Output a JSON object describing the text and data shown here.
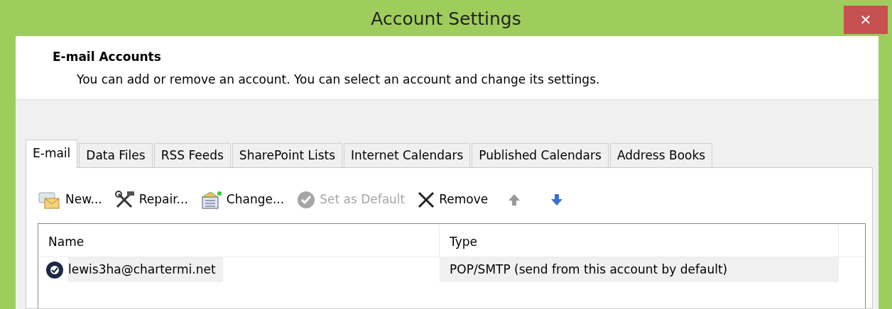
{
  "window": {
    "title": "Account Settings",
    "close": "✕"
  },
  "header": {
    "heading": "E-mail Accounts",
    "description": "You can add or remove an account. You can select an account and change its settings."
  },
  "tabs": [
    {
      "label": "E-mail",
      "selected": true
    },
    {
      "label": "Data Files",
      "selected": false
    },
    {
      "label": "RSS Feeds",
      "selected": false
    },
    {
      "label": "SharePoint Lists",
      "selected": false
    },
    {
      "label": "Internet Calendars",
      "selected": false
    },
    {
      "label": "Published Calendars",
      "selected": false
    },
    {
      "label": "Address Books",
      "selected": false
    }
  ],
  "toolbar": [
    {
      "kind": "new",
      "label": "New...",
      "disabled": false
    },
    {
      "kind": "repair",
      "label": "Repair...",
      "disabled": false
    },
    {
      "kind": "change",
      "label": "Change...",
      "disabled": false
    },
    {
      "kind": "default",
      "label": "Set as Default",
      "disabled": true
    },
    {
      "kind": "remove",
      "label": "Remove",
      "disabled": false
    },
    {
      "kind": "up",
      "disabled": true
    },
    {
      "kind": "down",
      "disabled": false
    }
  ],
  "table": {
    "columns": [
      "Name",
      "Type"
    ],
    "rows": [
      {
        "name": "lewis3ha@chartermi.net",
        "type": "POP/SMTP (send from this account by default)",
        "selected": true
      }
    ]
  }
}
